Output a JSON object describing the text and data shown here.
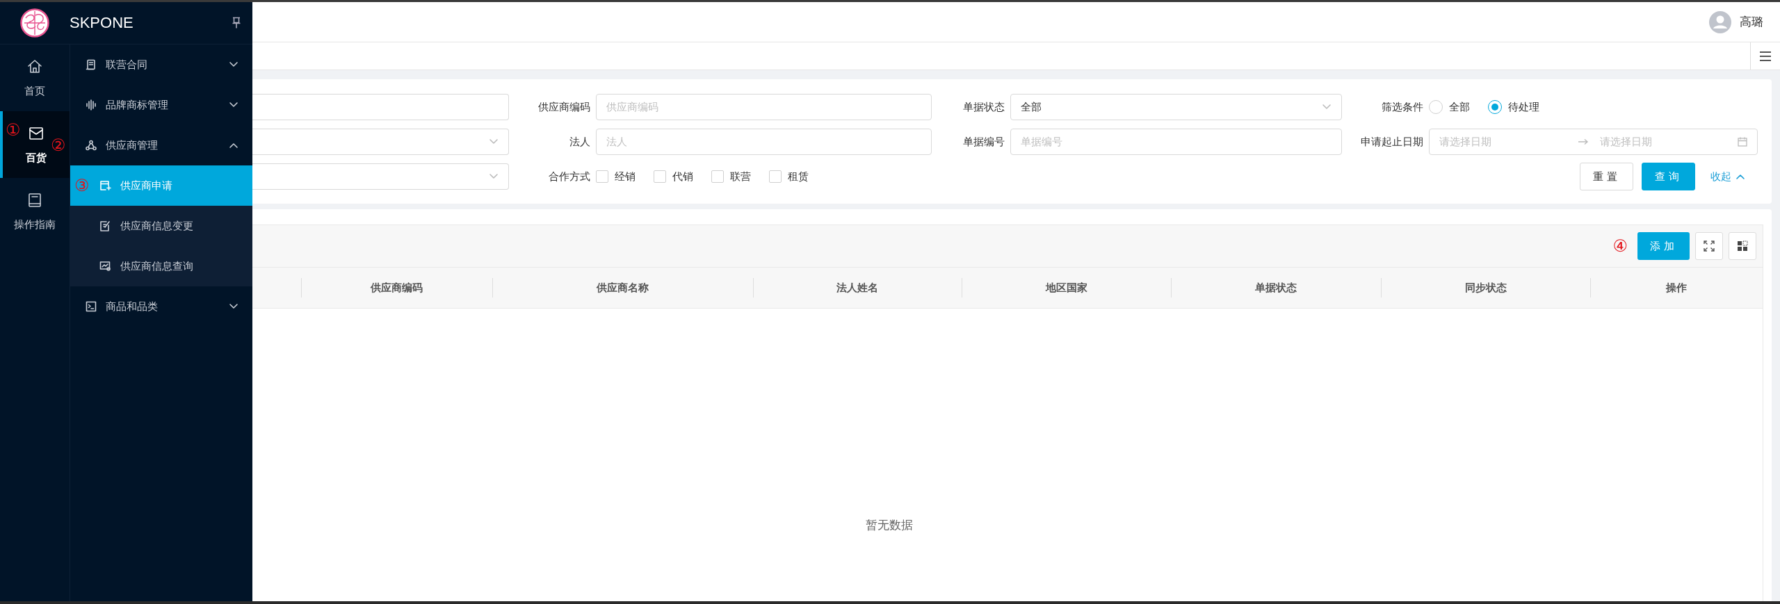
{
  "sidebar": {
    "brand": "SKPONE",
    "rail": [
      {
        "label": "首页",
        "selected": false
      },
      {
        "label": "百货",
        "selected": true,
        "annotation": "①"
      },
      {
        "label": "操作指南",
        "selected": false
      }
    ],
    "menu": [
      {
        "label": "联营合同",
        "expanded": false
      },
      {
        "label": "品牌商标管理",
        "expanded": false
      },
      {
        "label": "供应商管理",
        "expanded": true,
        "annotation": "②",
        "children": [
          {
            "label": "供应商申请",
            "selected": true,
            "annotation": "③"
          },
          {
            "label": "供应商信息变更",
            "selected": false
          },
          {
            "label": "供应商信息查询",
            "selected": false
          }
        ]
      },
      {
        "label": "商品和品类",
        "expanded": false
      }
    ]
  },
  "header": {
    "user": "高璐"
  },
  "filters": {
    "fields": [
      {
        "kind": "input"
      },
      {
        "kind": "input",
        "label": "供应商编码",
        "placeholder": "供应商编码"
      },
      {
        "kind": "select",
        "label": "单据状态",
        "value": "全部"
      },
      {
        "kind": "radio",
        "label": "筛选条件",
        "options": [
          {
            "label": "全部",
            "selected": false
          },
          {
            "label": "待处理",
            "selected": true
          }
        ]
      },
      {
        "kind": "select"
      },
      {
        "kind": "input",
        "label": "法人",
        "placeholder": "法人"
      },
      {
        "kind": "input",
        "label": "单据编号",
        "placeholder": "单据编号"
      },
      {
        "kind": "daterange",
        "label": "申请起止日期",
        "start_placeholder": "请选择日期",
        "end_placeholder": "请选择日期"
      },
      {
        "kind": "select"
      },
      {
        "kind": "checkbox",
        "label": "合作方式",
        "options": [
          {
            "label": "经销",
            "checked": false
          },
          {
            "label": "代销",
            "checked": false
          },
          {
            "label": "联营",
            "checked": false
          },
          {
            "label": "租赁",
            "checked": false
          }
        ]
      }
    ],
    "actions": [
      {
        "label": "重置",
        "kind": "default"
      },
      {
        "label": "查询",
        "kind": "primary"
      },
      {
        "label": "收起",
        "kind": "link"
      }
    ]
  },
  "table": {
    "add_button": "添加",
    "annotation": "④",
    "columns": [
      "供应商编码",
      "供应商名称",
      "法人姓名",
      "地区国家",
      "单据状态",
      "同步状态",
      "操作"
    ],
    "empty_text": "暂无数据"
  }
}
